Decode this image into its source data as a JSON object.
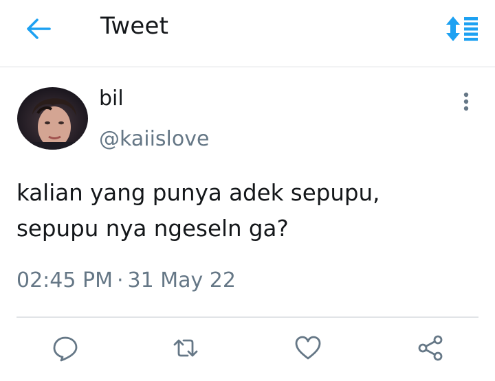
{
  "header": {
    "title": "Tweet",
    "back_icon": "arrow-left-icon",
    "sort_icon": "sort-list-icon",
    "accent_color": "#1da1f2"
  },
  "tweet": {
    "author": {
      "display_name": "bil",
      "handle": "@kaiislove"
    },
    "text_lines": [
      "kalian yang punya adek sepupu,",
      "sepupu nya ngeseln ga?"
    ],
    "time": "02:45 PM",
    "separator": "·",
    "date": "31 May 22"
  },
  "actions": [
    {
      "name": "reply",
      "icon": "reply-icon"
    },
    {
      "name": "retweet",
      "icon": "retweet-icon"
    },
    {
      "name": "like",
      "icon": "heart-icon"
    },
    {
      "name": "share",
      "icon": "share-icon"
    }
  ],
  "colors": {
    "text": "#14171a",
    "secondary": "#657786",
    "icon": "#657786",
    "divider": "#e1e4e7"
  }
}
